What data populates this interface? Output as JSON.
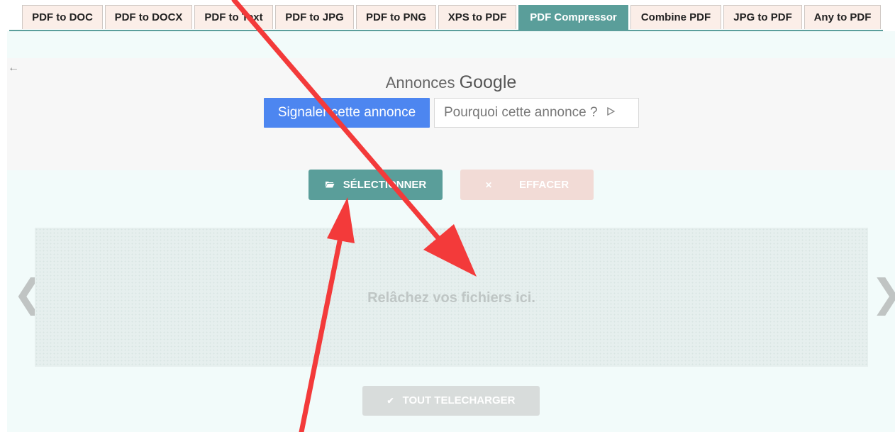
{
  "tabs": [
    {
      "label": "PDF to DOC"
    },
    {
      "label": "PDF to DOCX"
    },
    {
      "label": "PDF to Text"
    },
    {
      "label": "PDF to JPG"
    },
    {
      "label": "PDF to PNG"
    },
    {
      "label": "XPS to PDF"
    },
    {
      "label": "PDF Compressor",
      "active": true
    },
    {
      "label": "Combine PDF"
    },
    {
      "label": "JPG to PDF"
    },
    {
      "label": "Any to PDF"
    }
  ],
  "ad": {
    "back_glyph": "←",
    "title_prefix": "Annonces",
    "title_brand": "Google",
    "report_label": "Signaler cette annonce",
    "why_label": "Pourquoi cette annonce ?",
    "why_icon": "ad-choices-icon"
  },
  "actions": {
    "select_label": "SÉLECTIONNER",
    "select_icon": "folder-open-icon",
    "clear_label": "EFFACER",
    "clear_icon": "close-icon",
    "download_label": "TOUT TELECHARGER",
    "download_icon": "checkmark-icon"
  },
  "dropzone": {
    "text": "Relâchez vos fichiers ici."
  },
  "carousel": {
    "prev_glyph": "❮",
    "next_glyph": "❯"
  },
  "colors": {
    "accent_teal": "#5a9e9a",
    "tab_bg": "#fbeee8",
    "ad_blue": "#4d86f0",
    "annotation_red": "#f33a3a"
  }
}
